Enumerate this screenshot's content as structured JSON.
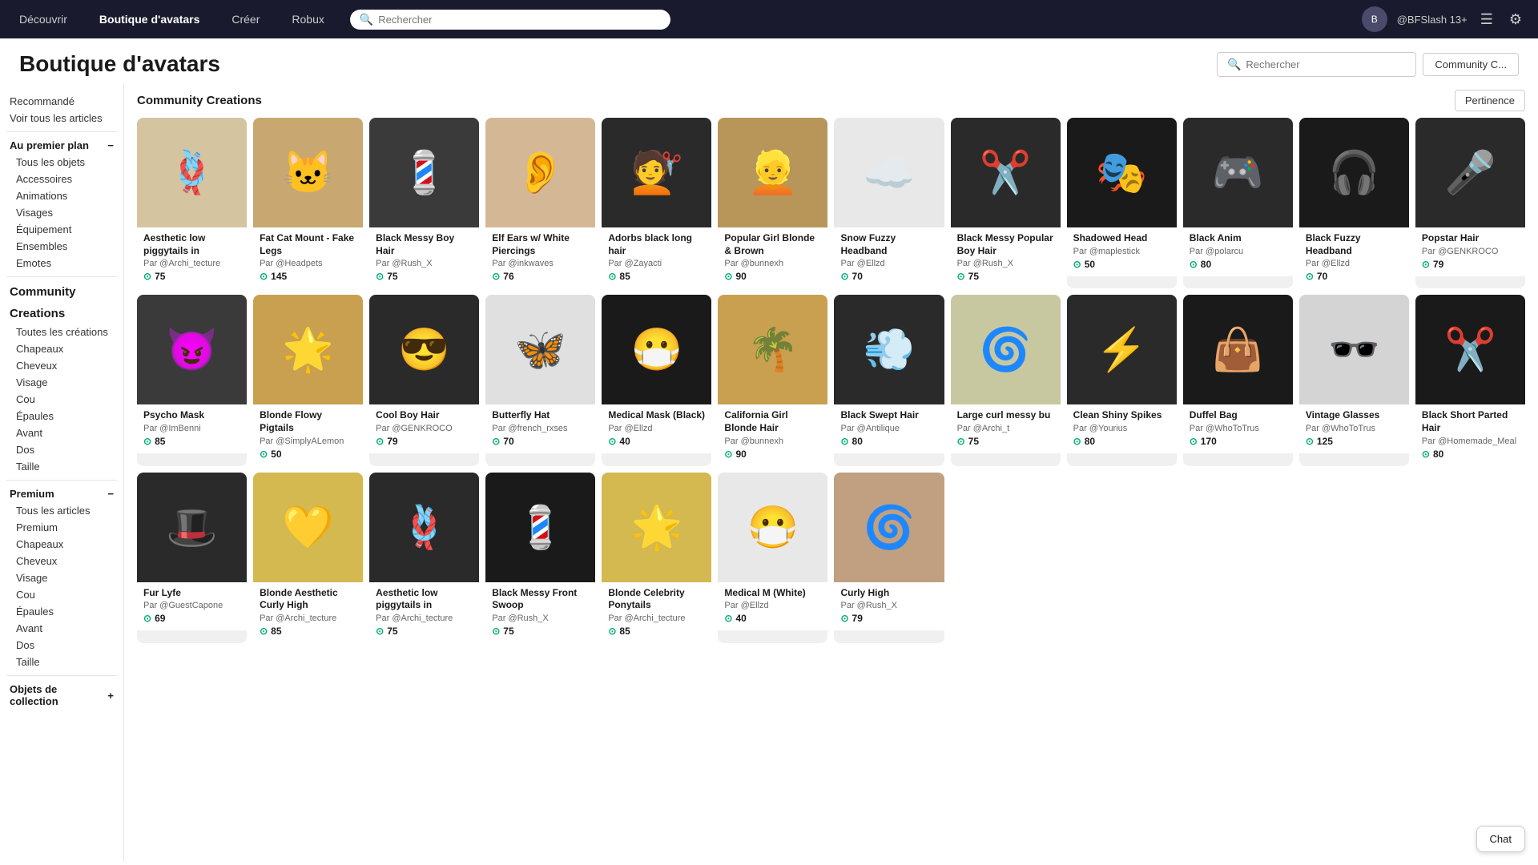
{
  "topNav": {
    "links": [
      "Découvrir",
      "Boutique d'avatars",
      "Créer",
      "Robux"
    ],
    "searchPlaceholder": "Rechercher",
    "user": "@BFSlash 13+",
    "chatLabel": "Chat"
  },
  "pageHeader": {
    "title": "Boutique d'avatars",
    "searchPlaceholder": "Rechercher",
    "communityBtnLabel": "Community C..."
  },
  "contentHeader": {
    "title": "Community Creations",
    "sortLabel": "Pertinence"
  },
  "sidebar": {
    "recommendedLabel": "Recommandé",
    "viewAllLabel": "Voir tous les articles",
    "auPremierPlan": "Au premier plan",
    "sections1": [
      "Tous les objets",
      "Accessoires",
      "Animations",
      "Visages",
      "Équipement",
      "Ensembles",
      "Emotes"
    ],
    "community": "Community",
    "creations": "Creations",
    "creationsItems": [
      "Toutes les créations",
      "Chapeaux",
      "Cheveux",
      "Visage",
      "Cou",
      "Épaules",
      "Avant",
      "Dos",
      "Taille"
    ],
    "premium": "Premium",
    "premiumItems": [
      "Tous les articles",
      "Premium",
      "Chapeaux",
      "Cheveux",
      "Visage",
      "Cou",
      "Épaules",
      "Avant",
      "Dos",
      "Taille"
    ],
    "collectibles": "Objets de collection"
  },
  "items": [
    {
      "name": "Aesthetic low piggytails in",
      "author": "@Archi_tecture",
      "price": "75",
      "emoji": "🪢",
      "bg": "#d4c4a0"
    },
    {
      "name": "Fat Cat Mount - Fake Legs",
      "author": "@Headpets",
      "price": "145",
      "emoji": "🐱",
      "bg": "#c8a870"
    },
    {
      "name": "Black Messy Boy Hair",
      "author": "@Rush_X",
      "price": "75",
      "emoji": "💈",
      "bg": "#3a3a3a"
    },
    {
      "name": "Elf Ears w/ White Piercings",
      "author": "@inkwaves",
      "price": "76",
      "emoji": "👂",
      "bg": "#d4b896"
    },
    {
      "name": "Adorbs black long hair",
      "author": "@Zayacti",
      "price": "85",
      "emoji": "💇",
      "bg": "#2a2a2a"
    },
    {
      "name": "Popular Girl Blonde & Brown",
      "author": "@bunnexh",
      "price": "90",
      "emoji": "👱",
      "bg": "#b8965a"
    },
    {
      "name": "Snow Fuzzy Headband",
      "author": "@Ellzd",
      "price": "70",
      "emoji": "☁️",
      "bg": "#e8e8e8"
    },
    {
      "name": "Black Messy Popular Boy Hair",
      "author": "@Rush_X",
      "price": "75",
      "emoji": "✂️",
      "bg": "#2a2a2a"
    },
    {
      "name": "Shadowed Head",
      "author": "@maplestick",
      "price": "50",
      "emoji": "🎭",
      "bg": "#1a1a1a"
    },
    {
      "name": "Black Anim",
      "author": "@polarcu",
      "price": "80",
      "emoji": "🎮",
      "bg": "#2a2a2a"
    },
    {
      "name": "Black Fuzzy Headband",
      "author": "@Ellzd",
      "price": "70",
      "emoji": "🎧",
      "bg": "#1a1a1a"
    },
    {
      "name": "Popstar Hair",
      "author": "@GENKROCO",
      "price": "79",
      "emoji": "🎤",
      "bg": "#2a2a2a"
    },
    {
      "name": "Psycho Mask",
      "author": "@ImBenni",
      "price": "85",
      "emoji": "😈",
      "bg": "#3a3a3a"
    },
    {
      "name": "Blonde Flowy Pigtails",
      "author": "@SimplyALemon",
      "price": "50",
      "emoji": "🌟",
      "bg": "#c8a050"
    },
    {
      "name": "Cool Boy Hair",
      "author": "@GENKROCO",
      "price": "79",
      "emoji": "😎",
      "bg": "#2a2a2a"
    },
    {
      "name": "Butterfly Hat",
      "author": "@french_rxses",
      "price": "70",
      "emoji": "🦋",
      "bg": "#e0e0e0"
    },
    {
      "name": "Medical Mask (Black)",
      "author": "@Ellzd",
      "price": "40",
      "emoji": "😷",
      "bg": "#1a1a1a"
    },
    {
      "name": "California Girl Blonde Hair",
      "author": "@bunnexh",
      "price": "90",
      "emoji": "🌴",
      "bg": "#c8a050"
    },
    {
      "name": "Black Swept Hair",
      "author": "@Antilique",
      "price": "80",
      "emoji": "💨",
      "bg": "#2a2a2a"
    },
    {
      "name": "Large curl messy bu",
      "author": "@Archi_t",
      "price": "75",
      "emoji": "🌀",
      "bg": "#c8c8a0"
    },
    {
      "name": "Clean Shiny Spikes",
      "author": "@Yourius",
      "price": "80",
      "emoji": "⚡",
      "bg": "#2a2a2a"
    },
    {
      "name": "Duffel Bag",
      "author": "@WhoToTrus",
      "price": "170",
      "emoji": "👜",
      "bg": "#1a1a1a"
    },
    {
      "name": "Vintage Glasses",
      "author": "@WhoToTrus",
      "price": "125",
      "emoji": "🕶️",
      "bg": "#d4d4d4"
    },
    {
      "name": "Black Short Parted Hair",
      "author": "@Homemade_Meal",
      "price": "80",
      "emoji": "✂️",
      "bg": "#1a1a1a"
    },
    {
      "name": "Fur Lyfe",
      "author": "@GuestCapone",
      "price": "69",
      "emoji": "🎩",
      "bg": "#2a2a2a"
    },
    {
      "name": "Blonde Aesthetic Curly High",
      "author": "@Archi_tecture",
      "price": "85",
      "emoji": "💛",
      "bg": "#d4b850"
    },
    {
      "name": "Aesthetic low piggytails in",
      "author": "@Archi_tecture",
      "price": "75",
      "emoji": "🪢",
      "bg": "#2a2a2a"
    },
    {
      "name": "Black Messy Front Swoop",
      "author": "@Rush_X",
      "price": "75",
      "emoji": "💈",
      "bg": "#1a1a1a"
    },
    {
      "name": "Blonde Celebrity Ponytails",
      "author": "@Archi_tecture",
      "price": "85",
      "emoji": "🌟",
      "bg": "#d4b850"
    },
    {
      "name": "Medical M (White)",
      "author": "@Ellzd",
      "price": "40",
      "emoji": "😷",
      "bg": "#e8e8e8"
    },
    {
      "name": "Curly High",
      "author": "@Rush_X",
      "price": "79",
      "emoji": "🌀",
      "bg": "#c0a080"
    }
  ]
}
